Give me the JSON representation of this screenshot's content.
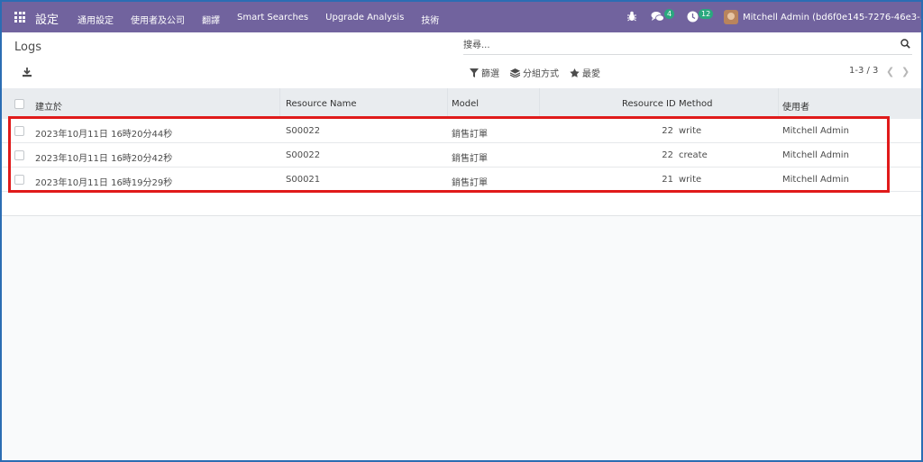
{
  "navbar": {
    "app_name": "設定",
    "menu": [
      "通用設定",
      "使用者及公司",
      "翻譯",
      "Smart Searches",
      "Upgrade Analysis",
      "技術"
    ],
    "messages_count": "4",
    "activities_count": "12",
    "user": "Mitchell Admin (bd6f0e145-7276-46e3-..."
  },
  "control": {
    "breadcrumb": "Logs",
    "search_placeholder": "搜尋...",
    "filters_label": "篩選",
    "group_by_label": "分組方式",
    "favorites_label": "最愛",
    "pager": "1-3 / 3"
  },
  "table": {
    "columns": [
      "建立於",
      "Resource Name",
      "Model",
      "Resource ID",
      "Method",
      "使用者"
    ],
    "rows": [
      {
        "created": "2023年10月11日 16時20分44秒",
        "resource_name": "S00022",
        "model": "銷售訂單",
        "resource_id": "22",
        "method": "write",
        "user": "Mitchell Admin"
      },
      {
        "created": "2023年10月11日 16時20分42秒",
        "resource_name": "S00022",
        "model": "銷售訂單",
        "resource_id": "22",
        "method": "create",
        "user": "Mitchell Admin"
      },
      {
        "created": "2023年10月11日 16時19分29秒",
        "resource_name": "S00021",
        "model": "銷售訂單",
        "resource_id": "21",
        "method": "write",
        "user": "Mitchell Admin"
      }
    ]
  },
  "colors": {
    "navbar": "#71639e",
    "highlight": "#e01a1a",
    "badge": "#2aa87e"
  }
}
